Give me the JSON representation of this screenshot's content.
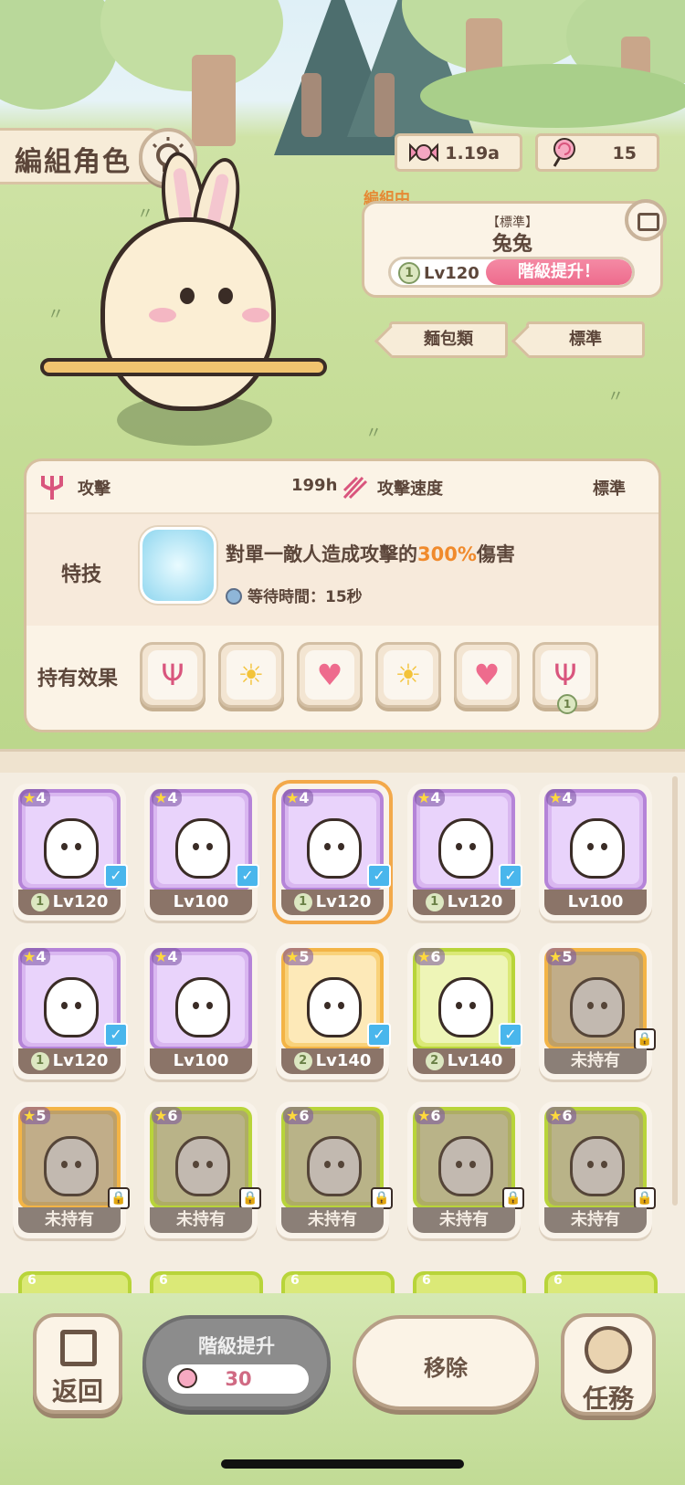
{
  "title": "編組角色",
  "currency": {
    "candy": "1.19a",
    "lollipop": "15"
  },
  "party": {
    "tag": "編組中",
    "type": "【標準】",
    "name": "兔兔",
    "tier": "1",
    "level": "Lv120",
    "upgrade_label": "階級提升！"
  },
  "tags": [
    "麵包類",
    "標準"
  ],
  "stats": {
    "attack_label": "攻擊",
    "attack_value": "199h",
    "speed_label": "攻擊速度",
    "speed_value": "標準",
    "skill_label": "特技",
    "skill_desc_pre": "對單一敵人造成攻擊的",
    "skill_desc_pct": "300%",
    "skill_desc_post": "傷害",
    "skill_wait": "等待時間：15秒",
    "effects_label": "持有效果",
    "effects": [
      "trident-icon",
      "sun-badge-icon",
      "heart-icon",
      "sun-badge-icon",
      "heart-icon",
      "trident-icon"
    ],
    "effect_last_tier": "1"
  },
  "roster": [
    {
      "stars": "4",
      "tier": "1",
      "level": "Lv120",
      "checked": true,
      "color": "purple"
    },
    {
      "stars": "4",
      "tier": "",
      "level": "Lv100",
      "checked": true,
      "color": "purple"
    },
    {
      "stars": "4",
      "tier": "1",
      "level": "Lv120",
      "checked": true,
      "color": "purple",
      "selected": true
    },
    {
      "stars": "4",
      "tier": "1",
      "level": "Lv120",
      "checked": true,
      "color": "purple"
    },
    {
      "stars": "4",
      "tier": "",
      "level": "Lv100",
      "checked": false,
      "color": "purple"
    },
    {
      "stars": "4",
      "tier": "1",
      "level": "Lv120",
      "checked": true,
      "color": "purple"
    },
    {
      "stars": "4",
      "tier": "",
      "level": "Lv100",
      "checked": false,
      "color": "purple"
    },
    {
      "stars": "5",
      "tier": "2",
      "level": "Lv140",
      "checked": true,
      "color": "orange"
    },
    {
      "stars": "6",
      "tier": "2",
      "level": "Lv140",
      "checked": true,
      "color": "green"
    },
    {
      "stars": "5",
      "tier": "",
      "level": "未持有",
      "locked": true,
      "color": "orange"
    },
    {
      "stars": "5",
      "tier": "",
      "level": "未持有",
      "locked": true,
      "color": "orange"
    },
    {
      "stars": "6",
      "tier": "",
      "level": "未持有",
      "locked": true,
      "color": "green"
    },
    {
      "stars": "6",
      "tier": "",
      "level": "未持有",
      "locked": true,
      "color": "green"
    },
    {
      "stars": "6",
      "tier": "",
      "level": "未持有",
      "locked": true,
      "color": "green"
    },
    {
      "stars": "6",
      "tier": "",
      "level": "未持有",
      "locked": true,
      "color": "green"
    }
  ],
  "roster_peek_stars": [
    "6",
    "6",
    "6",
    "6",
    "6"
  ],
  "bottom": {
    "back": "返回",
    "upgrade": "階級提升",
    "upgrade_cost": "30",
    "remove": "移除",
    "mission": "任務"
  }
}
